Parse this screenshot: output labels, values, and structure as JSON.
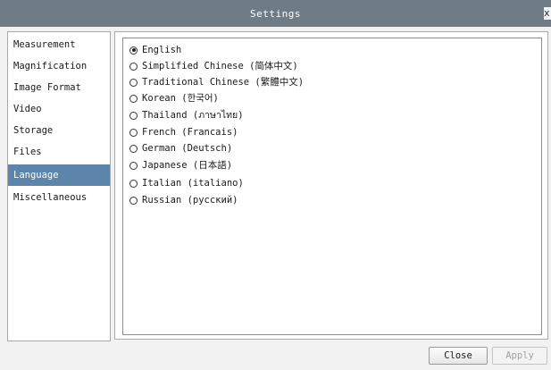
{
  "window": {
    "title": "Settings",
    "close_label": "x"
  },
  "sidebar": {
    "items": [
      {
        "label": "Measurement",
        "selected": false
      },
      {
        "label": "Magnification",
        "selected": false
      },
      {
        "label": "Image Format",
        "selected": false
      },
      {
        "label": "Video",
        "selected": false
      },
      {
        "label": "Storage",
        "selected": false
      },
      {
        "label": "Files",
        "selected": false
      },
      {
        "label": "Language",
        "selected": true
      },
      {
        "label": "Miscellaneous",
        "selected": false
      }
    ]
  },
  "language": {
    "selected": "English",
    "options": [
      "English",
      "Simplified Chinese (简体中文)",
      "Traditional Chinese (繁體中文)",
      "Korean (한국어)",
      "Thailand (ภาษาไทย)",
      "French (Francais)",
      "German (Deutsch)",
      "Japanese (日本語)",
      "Italian (italiano)",
      "Russian (русский)"
    ]
  },
  "buttons": {
    "close": "Close",
    "apply": "Apply",
    "apply_enabled": false
  },
  "colors": {
    "titlebar": "#6f7c86",
    "selection": "#5d84a9"
  }
}
